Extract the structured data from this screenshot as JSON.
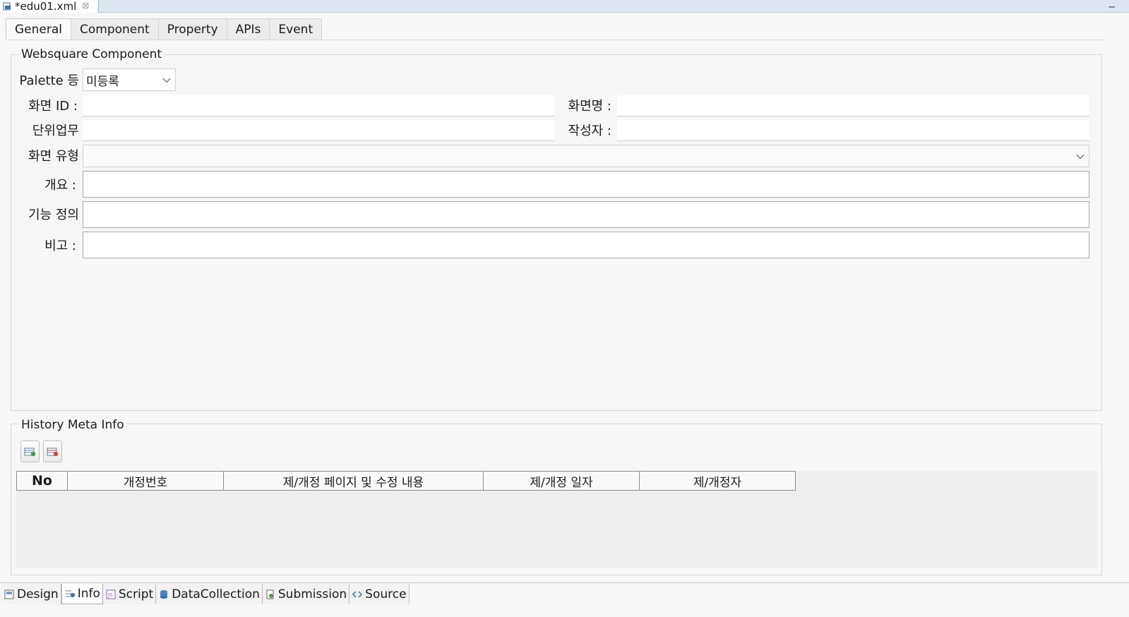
{
  "editor": {
    "file_tab": "*edu01.xml",
    "close_glyph": "☒"
  },
  "tabs": [
    "General",
    "Component",
    "Property",
    "APIs",
    "Event"
  ],
  "component_group": {
    "title": "Websquare Component",
    "palette_label": "Palette 등",
    "palette_value": "미등록",
    "screen_id_label": "화면 ID :",
    "screen_name_label": "화면명 :",
    "unit_task_label": "단위업무",
    "author_label": "작성자 :",
    "screen_type_label": "화면 유형",
    "summary_label": "개요 :",
    "function_label": "기능 정의",
    "remarks_label": "비고 :"
  },
  "history_group": {
    "title": "History Meta Info",
    "columns": [
      "No",
      "개정번호",
      "제/개정 페이지 및 수정 내용",
      "제/개정 일자",
      "제/개정자"
    ]
  },
  "bottom_tabs": [
    "Design",
    "Info",
    "Script",
    "DataCollection",
    "Submission",
    "Source"
  ],
  "colors": {
    "accent": "#dce6f2",
    "table_bg": "#eeeeee"
  }
}
